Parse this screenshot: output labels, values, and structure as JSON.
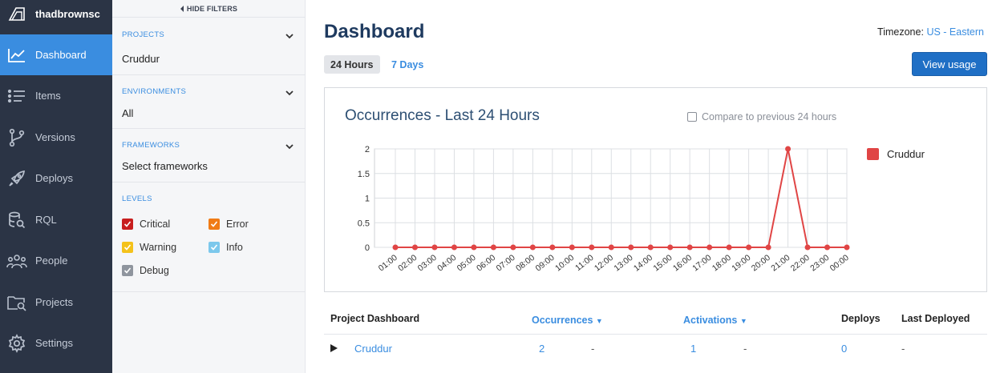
{
  "sidebar": {
    "username": "thadbrownsc",
    "items": [
      {
        "label": "Dashboard",
        "icon": "chart-line-icon",
        "active": true
      },
      {
        "label": "Items",
        "icon": "list-icon",
        "active": false
      },
      {
        "label": "Versions",
        "icon": "branch-icon",
        "active": false
      },
      {
        "label": "Deploys",
        "icon": "rocket-icon",
        "active": false
      },
      {
        "label": "RQL",
        "icon": "database-search-icon",
        "active": false
      },
      {
        "label": "People",
        "icon": "people-icon",
        "active": false
      },
      {
        "label": "Projects",
        "icon": "folder-search-icon",
        "active": false
      },
      {
        "label": "Settings",
        "icon": "gear-icon",
        "active": false
      }
    ]
  },
  "filters": {
    "hide_label": "HIDE FILTERS",
    "projects": {
      "title": "PROJECTS",
      "value": "Cruddur"
    },
    "environments": {
      "title": "ENVIRONMENTS",
      "value": "All"
    },
    "frameworks": {
      "title": "FRAMEWORKS",
      "value": "Select frameworks"
    },
    "levels": {
      "title": "LEVELS",
      "items": [
        {
          "label": "Critical",
          "color": "#c81e1e",
          "checked": true
        },
        {
          "label": "Error",
          "color": "#f07b16",
          "checked": true
        },
        {
          "label": "Warning",
          "color": "#f4c21b",
          "checked": true
        },
        {
          "label": "Info",
          "color": "#7cc8ec",
          "checked": true
        },
        {
          "label": "Debug",
          "color": "#8f959e",
          "checked": true
        }
      ]
    }
  },
  "main": {
    "title": "Dashboard",
    "timezone_label": "Timezone:",
    "timezone_value": "US - Eastern",
    "range_24": "24 Hours",
    "range_7": "7 Days",
    "view_usage": "View usage",
    "compare_label": "Compare to previous 24 hours"
  },
  "chart_data": {
    "type": "line",
    "title": "Occurrences - Last 24 Hours",
    "x": [
      "01:00",
      "02:00",
      "03:00",
      "04:00",
      "05:00",
      "06:00",
      "07:00",
      "08:00",
      "09:00",
      "10:00",
      "11:00",
      "12:00",
      "13:00",
      "14:00",
      "15:00",
      "16:00",
      "17:00",
      "18:00",
      "19:00",
      "20:00",
      "21:00",
      "22:00",
      "23:00",
      "00:00"
    ],
    "series": [
      {
        "name": "Cruddur",
        "color": "#e04545",
        "values": [
          0,
          0,
          0,
          0,
          0,
          0,
          0,
          0,
          0,
          0,
          0,
          0,
          0,
          0,
          0,
          0,
          0,
          0,
          0,
          0,
          2,
          0,
          0,
          0
        ]
      }
    ],
    "y_ticks": [
      "0",
      "0.5",
      "1",
      "1.5",
      "2"
    ],
    "ylim": [
      0,
      2
    ],
    "grid": true,
    "legend": "right"
  },
  "table": {
    "headers": {
      "project": "Project Dashboard",
      "occurrences": "Occurrences",
      "activations": "Activations",
      "deploys": "Deploys",
      "last_deployed": "Last Deployed"
    },
    "sort_indicator": "▼",
    "rows": [
      {
        "project": "Cruddur",
        "occurrences": "2",
        "occ_change": "-",
        "activations": "1",
        "act_change": "-",
        "deploys": "0",
        "last_deployed": "-"
      }
    ]
  }
}
